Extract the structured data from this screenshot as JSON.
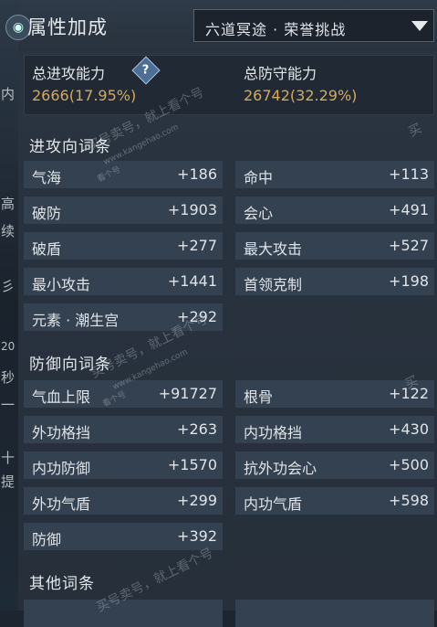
{
  "left_strip": [
    "内",
    "高",
    "续",
    "彡",
    "20",
    "秒",
    "一",
    "十",
    "提"
  ],
  "panel": {
    "title": "属性加成",
    "mode_select": "六道冥途 · 荣誉挑战"
  },
  "totals": {
    "attack_label": "总进攻能力",
    "attack_value": "2666(17.95%)",
    "defense_label": "总防守能力",
    "defense_value": "26742(32.29%)",
    "help_glyph": "?"
  },
  "sections": {
    "offense_title": "进攻向词条",
    "offense": [
      {
        "label": "气海",
        "value": "+186"
      },
      {
        "label": "命中",
        "value": "+113"
      },
      {
        "label": "破防",
        "value": "+1903"
      },
      {
        "label": "会心",
        "value": "+491"
      },
      {
        "label": "破盾",
        "value": "+277"
      },
      {
        "label": "最大攻击",
        "value": "+527"
      },
      {
        "label": "最小攻击",
        "value": "+1441"
      },
      {
        "label": "首领克制",
        "value": "+198"
      },
      {
        "label": "元素 · 潮生宫",
        "value": "+292"
      }
    ],
    "defense_title": "防御向词条",
    "defense": [
      {
        "label": "气血上限",
        "value": "+91727"
      },
      {
        "label": "根骨",
        "value": "+122"
      },
      {
        "label": "外功格挡",
        "value": "+263"
      },
      {
        "label": "内功格挡",
        "value": "+430"
      },
      {
        "label": "内功防御",
        "value": "+1570"
      },
      {
        "label": "抗外功会心",
        "value": "+500"
      },
      {
        "label": "外功气盾",
        "value": "+299"
      },
      {
        "label": "内功气盾",
        "value": "+598"
      },
      {
        "label": "防御",
        "value": "+392"
      }
    ],
    "other_title": "其他词条"
  },
  "watermark": {
    "text": "买号卖号，就上看个号",
    "url": "www.kangehao.com",
    "badge": "看个号"
  }
}
